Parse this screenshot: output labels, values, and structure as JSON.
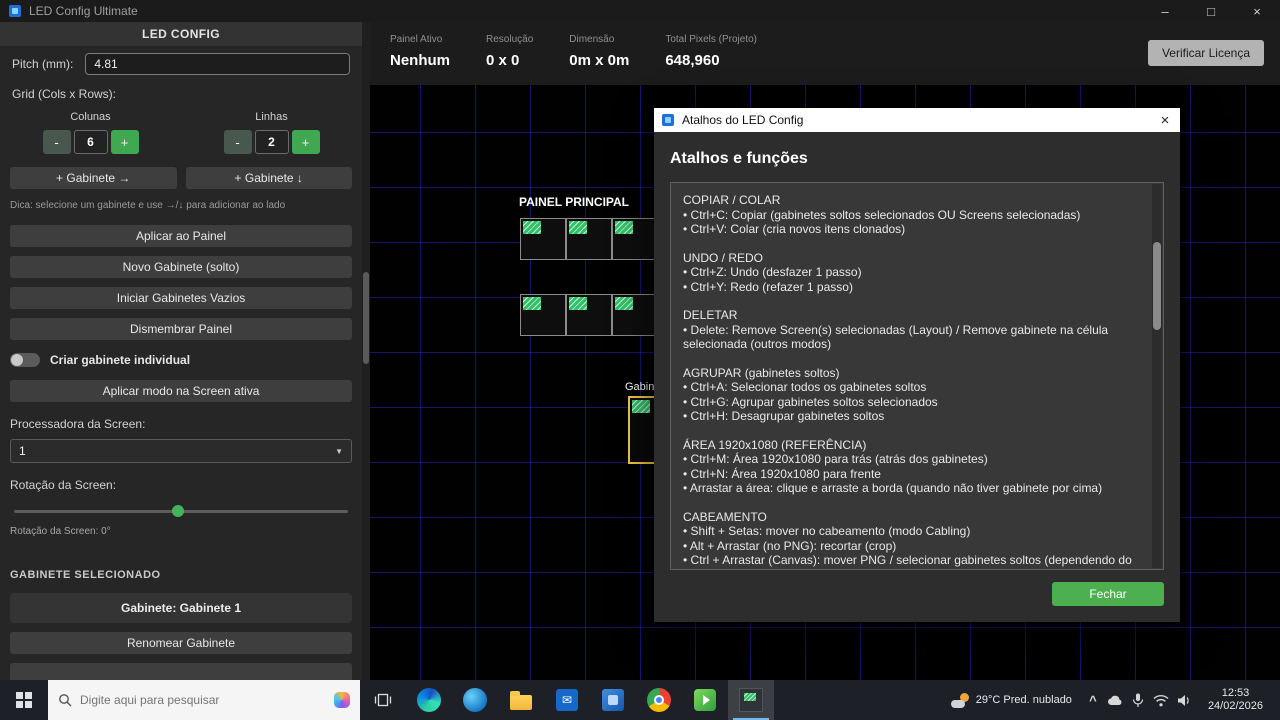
{
  "glyphs": {
    "minimize": "–",
    "maximize": "□",
    "close": "×",
    "chevron_down": "▼",
    "caret_up": "^"
  },
  "titlebar": {
    "title": "LED Config Ultimate"
  },
  "sidebar": {
    "header": "LED CONFIG",
    "pitch": {
      "label": "Pitch (mm):",
      "value": "4.81"
    },
    "grid_label": "Grid (Cols x Rows):",
    "columns": {
      "label": "Colunas",
      "value": "6",
      "minus": "-",
      "plus": "+"
    },
    "rows": {
      "label": "Linhas",
      "value": "2",
      "minus": "-",
      "plus": "+"
    },
    "add_cabinet_right": "+ Gabinete →",
    "add_cabinet_down": "+ Gabinete ↓",
    "hint": "Dica: selecione um gabinete e use →/↓ para adicionar ao lado",
    "action_buttons": [
      "Aplicar ao Painel",
      "Novo Gabinete (solto)",
      "Iniciar Gabinetes Vazios",
      "Dismembrar Painel"
    ],
    "toggle_label": "Criar gabinete individual",
    "apply_mode_label": "Aplicar modo na Screen ativa",
    "processor": {
      "label": "Processadora da Screen:",
      "value": "1"
    },
    "rotation": {
      "label": "Rotação da Screen:",
      "value_label": "Rotação da Screen: 0°"
    },
    "selected": {
      "header": "GABINETE SELECIONADO",
      "cabinet_label": "Gabinete: Gabinete 1",
      "rename_label": "Renomear Gabinete"
    }
  },
  "statusbar": {
    "stats": [
      {
        "label": "Painel Ativo",
        "value": "Nenhum"
      },
      {
        "label": "Resolução",
        "value": "0 x 0"
      },
      {
        "label": "Dimensão",
        "value": "0m x 0m"
      },
      {
        "label": "Total Pixels (Projeto)",
        "value": "648,960"
      }
    ],
    "license_button": "Verificar Licença"
  },
  "canvas": {
    "panel_title": "PAINEL PRINCIPAL",
    "grid": {
      "cols": 6,
      "rows": 2
    },
    "loose_cabinet_label": "Gabin"
  },
  "dialog": {
    "title": "Atalhos do LED Config",
    "heading": "Atalhos e funções",
    "close_button": "Fechar",
    "sections": [
      {
        "title": "COPIAR / COLAR",
        "body": "• Ctrl+C: Copiar (gabinetes soltos selecionados OU Screens selecionadas)\n• Ctrl+V: Colar (cria novos itens clonados)"
      },
      {
        "title": "UNDO / REDO",
        "body": "• Ctrl+Z: Undo (desfazer 1 passo)\n• Ctrl+Y: Redo (refazer 1 passo)"
      },
      {
        "title": "DELETAR",
        "body": "• Delete: Remove Screen(s) selecionadas (Layout) / Remove gabinete na célula selecionada (outros modos)"
      },
      {
        "title": "AGRUPAR (gabinetes soltos)",
        "body": "• Ctrl+A: Selecionar todos os gabinetes soltos\n• Ctrl+G: Agrupar gabinetes soltos selecionados\n• Ctrl+H: Desagrupar gabinetes soltos"
      },
      {
        "title": "ÁREA 1920x1080 (REFERÊNCIA)",
        "body": "• Ctrl+M: Área 1920x1080 para trás (atrás dos gabinetes)\n• Ctrl+N: Área 1920x1080 para frente\n• Arrastar a área: clique e arraste a borda (quando não tiver gabinete por cima)"
      },
      {
        "title": "CABEAMENTO",
        "body": "• Shift + Setas: mover no cabeamento (modo Cabling)\n• Alt + Arrastar (no PNG): recortar (crop)\n• Ctrl + Arrastar (Canvas): mover PNG / selecionar gabinetes soltos (dependendo do conte"
      }
    ]
  },
  "taskbar": {
    "search_placeholder": "Digite aqui para pesquisar",
    "weather": {
      "temp_condition": "29°C  Pred. nublado"
    },
    "clock": {
      "time": "12:53",
      "date": "24/02/2026"
    }
  }
}
